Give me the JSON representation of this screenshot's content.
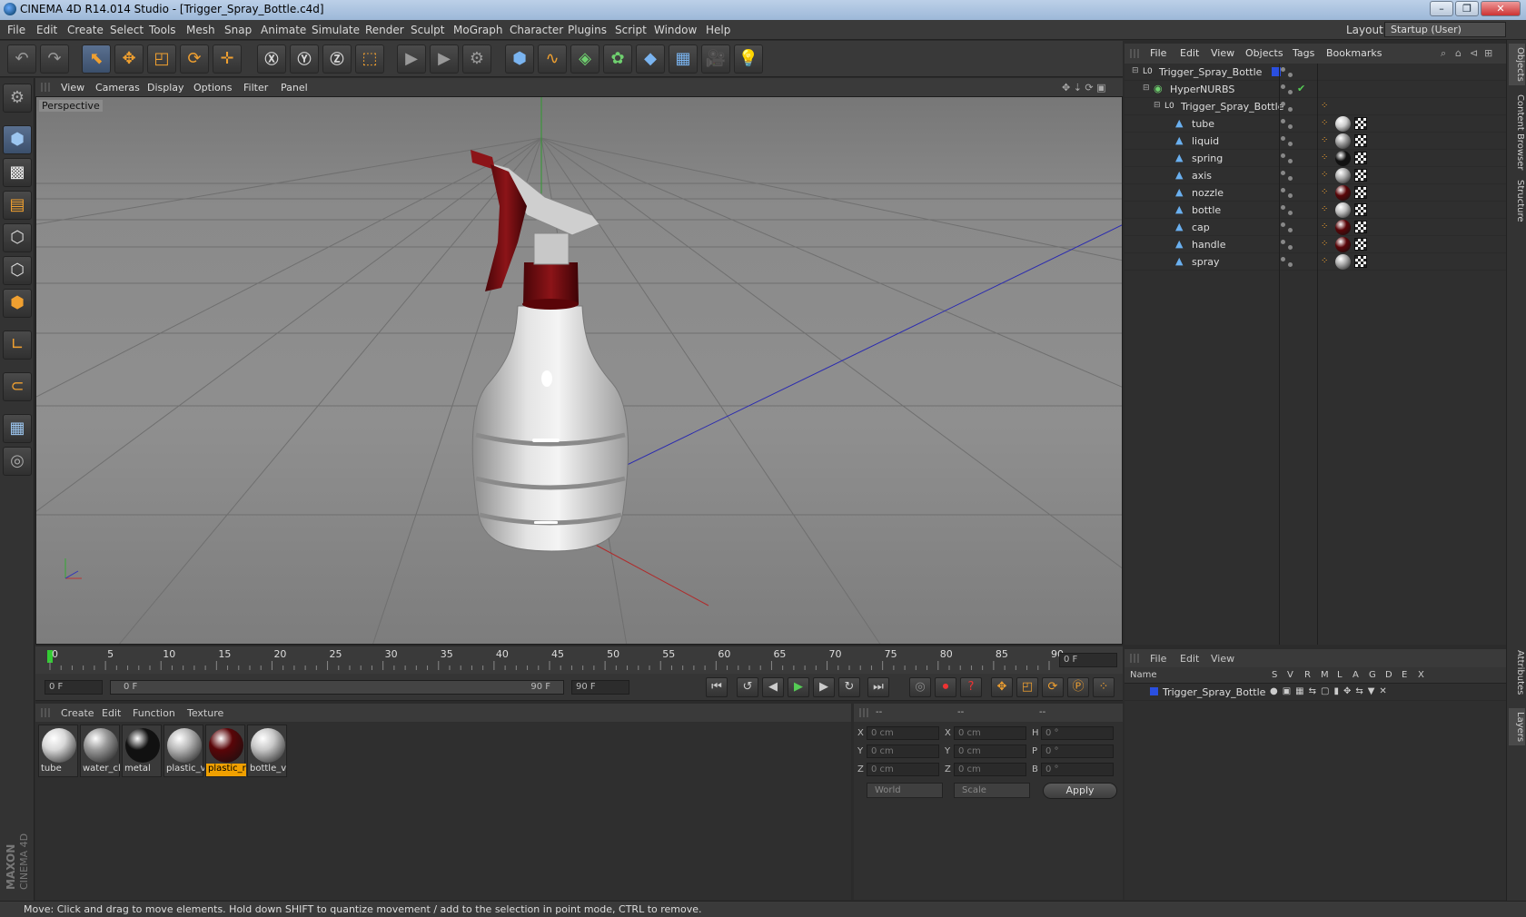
{
  "window": {
    "title": "CINEMA 4D R14.014 Studio - [Trigger_Spray_Bottle.c4d]",
    "controls": [
      "–",
      "❐",
      "✕"
    ]
  },
  "menubar": {
    "items": [
      "File",
      "Edit",
      "Create",
      "Select",
      "Tools",
      "Mesh",
      "Snap",
      "Animate",
      "Simulate",
      "Render",
      "Sculpt",
      "MoGraph",
      "Character",
      "Plugins",
      "Script",
      "Window",
      "Help"
    ],
    "layout_label": "Layout:",
    "layout_value": "Startup (User)"
  },
  "viewport": {
    "menu": [
      "View",
      "Cameras",
      "Display",
      "Options",
      "Filter",
      "Panel"
    ],
    "label": "Perspective"
  },
  "timeline": {
    "ticks": [
      "0",
      "5",
      "10",
      "15",
      "20",
      "25",
      "30",
      "35",
      "40",
      "45",
      "50",
      "55",
      "60",
      "65",
      "70",
      "75",
      "80",
      "85",
      "90"
    ],
    "current_frame": "0 F",
    "start_field": "0 F",
    "range_start": "0 F",
    "range_end": "90 F",
    "end_field": "90 F"
  },
  "materials": {
    "menu": [
      "Create",
      "Edit",
      "Function",
      "Texture"
    ],
    "items": [
      {
        "label": "tube",
        "color": "#d8d8d8"
      },
      {
        "label": "water_cl",
        "color": "#9a9a9a"
      },
      {
        "label": "metal",
        "color": "#111111"
      },
      {
        "label": "plastic_v",
        "color": "#b8b8b8"
      },
      {
        "label": "plastic_r",
        "color": "#5a0508"
      },
      {
        "label": "bottle_v",
        "color": "#c8c8c8"
      }
    ]
  },
  "coordinates": {
    "headers": [
      "--",
      "--",
      "--"
    ],
    "rows": [
      {
        "a": "X",
        "av": "0 cm",
        "b": "X",
        "bv": "0 cm",
        "c": "H",
        "cv": "0 °"
      },
      {
        "a": "Y",
        "av": "0 cm",
        "b": "Y",
        "bv": "0 cm",
        "c": "P",
        "cv": "0 °"
      },
      {
        "a": "Z",
        "av": "0 cm",
        "b": "Z",
        "bv": "0 cm",
        "c": "B",
        "cv": "0 °"
      }
    ],
    "mode1": "World",
    "mode2": "Scale",
    "apply": "Apply"
  },
  "objects": {
    "menu": [
      "File",
      "Edit",
      "View",
      "Objects",
      "Tags",
      "Bookmarks"
    ],
    "tree": [
      {
        "name": "Trigger_Spray_Bottle",
        "depth": 0,
        "icon": "L0"
      },
      {
        "name": "HyperNURBS",
        "depth": 1,
        "icon": "◉"
      },
      {
        "name": "Trigger_Spray_Bottle",
        "depth": 2,
        "icon": "L0"
      },
      {
        "name": "tube",
        "depth": 3,
        "icon": "▲",
        "mat": "#cccccc"
      },
      {
        "name": "liquid",
        "depth": 3,
        "icon": "▲",
        "mat": "#9a9a9a"
      },
      {
        "name": "spring",
        "depth": 3,
        "icon": "▲",
        "mat": "#111111"
      },
      {
        "name": "axis",
        "depth": 3,
        "icon": "▲",
        "mat": "#aaaaaa"
      },
      {
        "name": "nozzle",
        "depth": 3,
        "icon": "▲",
        "mat": "#5a0508"
      },
      {
        "name": "bottle",
        "depth": 3,
        "icon": "▲",
        "mat": "#bbbbbb"
      },
      {
        "name": "cap",
        "depth": 3,
        "icon": "▲",
        "mat": "#5a0508"
      },
      {
        "name": "handle",
        "depth": 3,
        "icon": "▲",
        "mat": "#5a0508"
      },
      {
        "name": "spray",
        "depth": 3,
        "icon": "▲",
        "mat": "#aaaaaa"
      }
    ]
  },
  "layers": {
    "menu": [
      "File",
      "Edit",
      "View"
    ],
    "columns": [
      "Name",
      "S",
      "V",
      "R",
      "M",
      "L",
      "A",
      "G",
      "D",
      "E",
      "X"
    ],
    "row": "Trigger_Spray_Bottle"
  },
  "sidetabs": [
    "Objects",
    "Content Browser",
    "Structure",
    "Attributes",
    "Layers"
  ],
  "status": "Move: Click and drag to move elements. Hold down SHIFT to quantize movement / add to the selection in point mode, CTRL to remove.",
  "brand": {
    "line1": "MAXON",
    "line2": "CINEMA 4D"
  }
}
